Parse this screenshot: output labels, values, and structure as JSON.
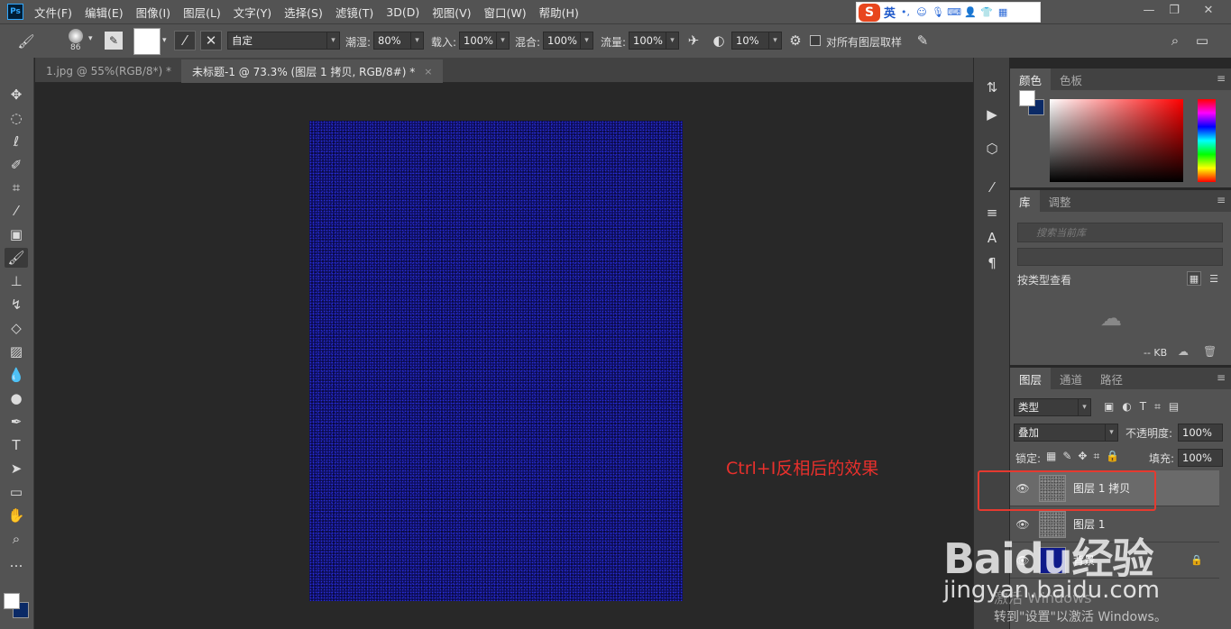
{
  "app": {
    "logo": "Ps"
  },
  "menu": [
    "文件(F)",
    "编辑(E)",
    "图像(I)",
    "图层(L)",
    "文字(Y)",
    "选择(S)",
    "滤镜(T)",
    "3D(D)",
    "视图(V)",
    "窗口(W)",
    "帮助(H)"
  ],
  "ime": {
    "logo": "S",
    "mode": "英",
    "punct": "•,"
  },
  "window": {
    "minimize": "—",
    "restore": "❐",
    "close": "✕"
  },
  "options": {
    "brush_size": "86",
    "preset": "自定",
    "opacity_label": "潮湿:",
    "opacity_value": "80%",
    "load_label": "载入:",
    "load_value": "100%",
    "mix_label": "混合:",
    "mix_value": "100%",
    "flow_label": "流量:",
    "flow_value": "100%",
    "smooth_value": "10%",
    "sample_all_label": "对所有图层取样"
  },
  "tabs": [
    {
      "label": "1.jpg @ 55%(RGB/8*) *",
      "close": "×"
    },
    {
      "label": "未标题-1 @ 73.3% (图层 1 拷贝, RGB/8#) *",
      "close": "×"
    }
  ],
  "annotation": "Ctrl+I反相后的效果",
  "panels": {
    "color_tabs": [
      "颜色",
      "色板"
    ],
    "library_tabs": [
      "库",
      "调整"
    ],
    "library_search_placeholder": "搜索当前库",
    "library_view": "按类型查看",
    "library_size": "-- KB",
    "layers_tabs": [
      "图层",
      "通道",
      "路径"
    ],
    "filter_kind": "类型",
    "blend_mode": "叠加",
    "opacity_label": "不透明度:",
    "opacity_value": "100%",
    "lock_label": "锁定:",
    "fill_label": "填充:",
    "fill_value": "100%",
    "menu_icon": "≡"
  },
  "layers": [
    {
      "name": "图层 1 拷贝",
      "selected": true
    },
    {
      "name": "图层 1",
      "selected": false
    },
    {
      "name": "背景",
      "selected": false,
      "locked": true
    }
  ],
  "watermark": {
    "brand": "Baidu经验",
    "url": "jingyan.baidu.com"
  },
  "windows_activation": {
    "line1": "激活 Windows",
    "line2": "转到\"设置\"以激活 Windows。"
  },
  "colors": {
    "canvas_blue": "#0e0f63",
    "highlight_red": "#e53a30",
    "foreground": "#ffffff",
    "background": "#0b2a66"
  }
}
